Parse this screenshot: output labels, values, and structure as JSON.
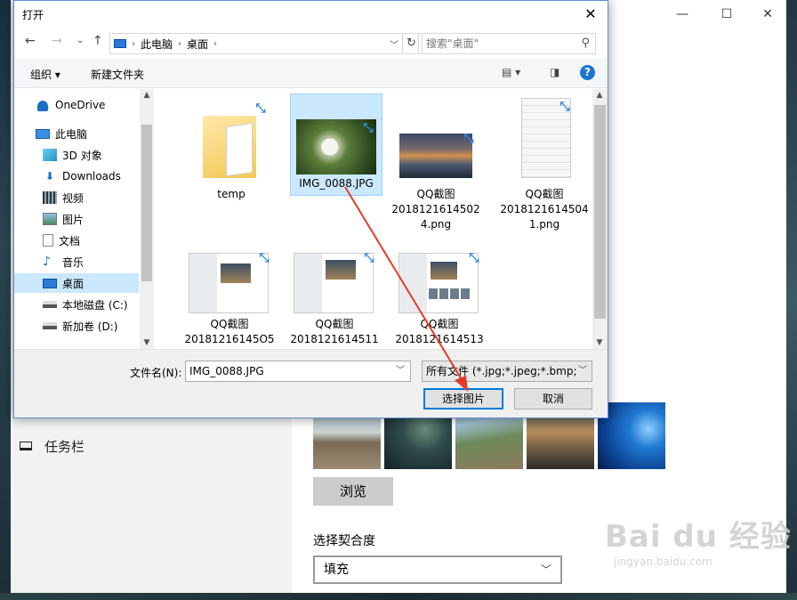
{
  "settings": {
    "window_controls": {
      "minimize": "—",
      "maximize": "☐",
      "close": "✕"
    },
    "taskbar_label": "任务栏",
    "browse_label": "浏览",
    "fit_label": "选择契合度",
    "fit_value": "填充"
  },
  "watermark": {
    "big": "Bai du 经验",
    "small": "jingyan.baidu.com"
  },
  "dialog": {
    "title": "打开",
    "close": "✕",
    "breadcrumb": [
      "此电脑",
      "桌面"
    ],
    "search_placeholder": "搜索\"桌面\"",
    "organize": "组织 ▾",
    "new_folder": "新建文件夹",
    "help": "?",
    "nav": {
      "back": "←",
      "forward": "→",
      "recent": "⌄",
      "up": "↑",
      "refresh": "↻"
    },
    "tree": [
      {
        "label": "OneDrive",
        "icon": "onedrive-icon"
      },
      {
        "label": "此电脑",
        "icon": "computer-icon"
      },
      {
        "label": "3D 对象",
        "icon": "3d-objects-icon"
      },
      {
        "label": "Downloads",
        "icon": "download-icon"
      },
      {
        "label": "视频",
        "icon": "video-icon"
      },
      {
        "label": "图片",
        "icon": "picture-icon"
      },
      {
        "label": "文档",
        "icon": "document-icon"
      },
      {
        "label": "音乐",
        "icon": "music-icon"
      },
      {
        "label": "桌面",
        "icon": "desktop-icon",
        "selected": true
      },
      {
        "label": "本地磁盘 (C:)",
        "icon": "drive-icon"
      },
      {
        "label": "新加卷 (D:)",
        "icon": "drive-icon"
      }
    ],
    "files": [
      {
        "name": "temp",
        "kind": "folder"
      },
      {
        "name": "IMG_0088.JPG",
        "kind": "photo",
        "selected": true
      },
      {
        "name": "QQ截图\n2018121614502\n4.png",
        "kind": "sunset"
      },
      {
        "name": "QQ截图\n2018121614504\n1.png",
        "kind": "menu"
      },
      {
        "name": "QQ截图\n20181216145O5",
        "kind": "settings"
      },
      {
        "name": "QQ截图\n2018121614511",
        "kind": "settings"
      },
      {
        "name": "QQ截图\n2018121614513",
        "kind": "settings2"
      }
    ],
    "filename_label": "文件名(N):",
    "filename_value": "IMG_0088.JPG",
    "filetype_value": "所有文件 (*.jpg;*.jpeg;*.bmp;*.",
    "open_button": "选择图片",
    "cancel_button": "取消"
  }
}
